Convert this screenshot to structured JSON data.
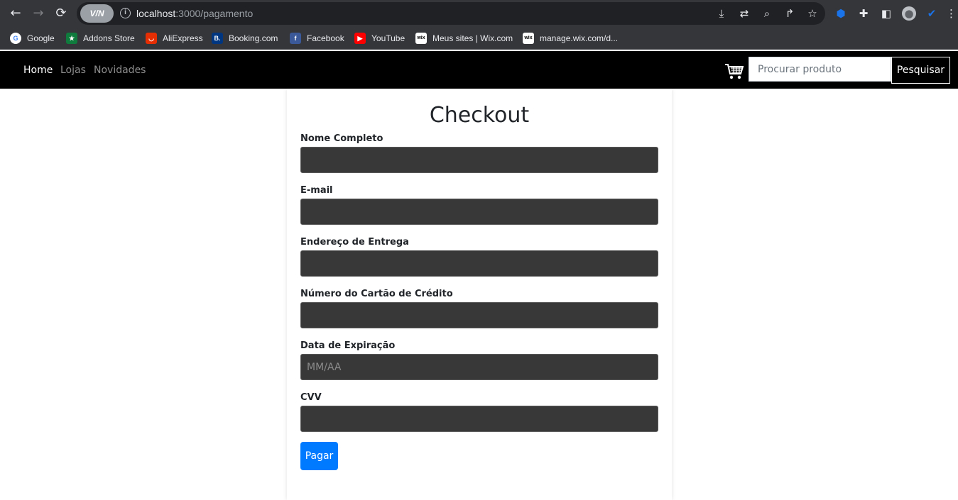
{
  "browser": {
    "url_host": "localhost",
    "url_path": ":3000/pagamento",
    "vpn_label": "V/N",
    "bookmarks": [
      {
        "label": "Google",
        "icon": "google-icon",
        "color": "#4285f4",
        "glyph": "G"
      },
      {
        "label": "Addons Store",
        "icon": "addons-store-icon",
        "color": "#0f7b3c",
        "glyph": "★"
      },
      {
        "label": "AliExpress",
        "icon": "aliexpress-icon",
        "color": "#e62e04",
        "glyph": "◡"
      },
      {
        "label": "Booking.com",
        "icon": "booking-icon",
        "color": "#003580",
        "glyph": "B."
      },
      {
        "label": "Facebook",
        "icon": "facebook-icon",
        "color": "#3b5998",
        "glyph": "f"
      },
      {
        "label": "YouTube",
        "icon": "youtube-icon",
        "color": "#ff0000",
        "glyph": "▶"
      },
      {
        "label": "Meus sites | Wix.com",
        "icon": "wix-icon",
        "color": "#ffffff",
        "glyph": "wix"
      },
      {
        "label": "manage.wix.com/d...",
        "icon": "wix-icon",
        "color": "#ffffff",
        "glyph": "wix"
      }
    ]
  },
  "navbar": {
    "links": [
      "Home",
      "Lojas",
      "Novidades"
    ],
    "search_placeholder": "Procurar produto",
    "search_button": "Pesquisar"
  },
  "checkout": {
    "title": "Checkout",
    "fields": [
      {
        "label": "Nome Completo",
        "placeholder": ""
      },
      {
        "label": "E-mail",
        "placeholder": ""
      },
      {
        "label": "Endereço de Entrega",
        "placeholder": ""
      },
      {
        "label": "Número do Cartão de Crédito",
        "placeholder": ""
      },
      {
        "label": "Data de Expiração",
        "placeholder": "MM/AA"
      },
      {
        "label": "CVV",
        "placeholder": ""
      }
    ],
    "submit_label": "Pagar"
  }
}
